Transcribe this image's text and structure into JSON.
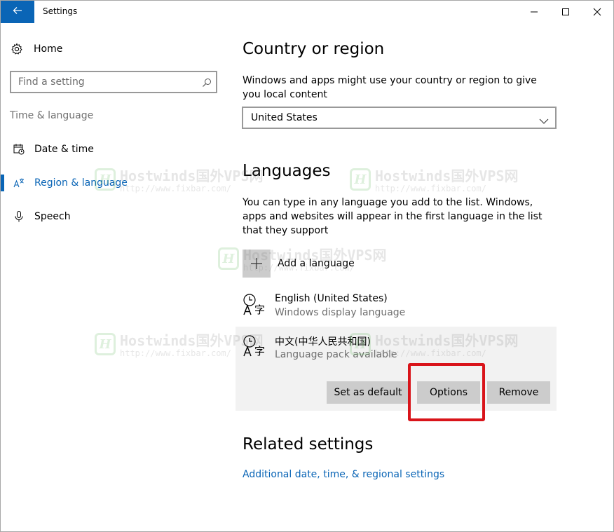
{
  "window": {
    "title": "Settings",
    "controls": {
      "minimize": "minimize-icon",
      "maximize": "maximize-icon",
      "close": "close-icon"
    }
  },
  "sidebar": {
    "home_label": "Home",
    "search": {
      "placeholder": "Find a setting"
    },
    "section_label": "Time & language",
    "items": [
      {
        "label": "Date & time",
        "icon": "calendar-clock-icon",
        "selected": false
      },
      {
        "label": "Region & language",
        "icon": "language-icon",
        "selected": true
      },
      {
        "label": "Speech",
        "icon": "microphone-icon",
        "selected": false
      }
    ]
  },
  "main": {
    "country": {
      "heading": "Country or region",
      "description": "Windows and apps might use your country or region to give you local content",
      "selected": "United States"
    },
    "languages": {
      "heading": "Languages",
      "description": "You can type in any language you add to the list. Windows, apps and websites will appear in the first language in the list that they support",
      "add_label": "Add a language",
      "list": [
        {
          "name": "English (United States)",
          "status": "Windows display language"
        },
        {
          "name": "中文(中华人民共和国)",
          "status": "Language pack available"
        }
      ],
      "buttons": {
        "set_default": "Set as default",
        "options": "Options",
        "remove": "Remove"
      }
    },
    "related": {
      "heading": "Related settings",
      "link": "Additional date, time, & regional settings"
    }
  },
  "watermark": {
    "line1": "Hostwinds国外VPS网",
    "line2": "http://www.fixbar.com/"
  },
  "colors": {
    "accent": "#0a65b6",
    "highlight": "#d9141a",
    "button": "#cccccc",
    "selected_row": "#f2f2f2"
  }
}
